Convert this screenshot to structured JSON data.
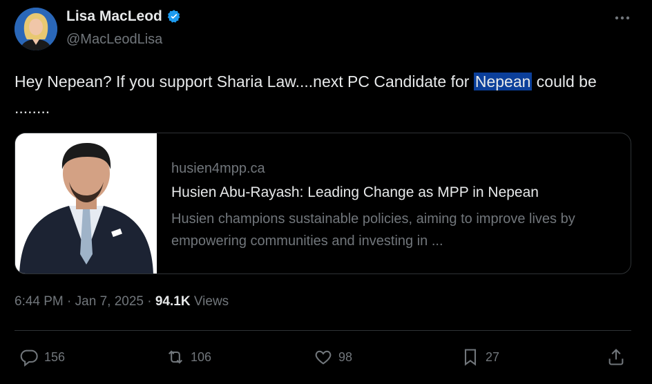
{
  "author": {
    "name": "Lisa MacLeod",
    "handle": "@MacLeodLisa",
    "verified_color": "#1d9bf0",
    "verified_icon": "verified-badge-icon"
  },
  "tweet": {
    "text_before": "Hey Nepean?  If you support Sharia Law....next PC Candidate for ",
    "text_highlight": "Nepean",
    "text_after": " could be ........"
  },
  "link_card": {
    "domain": "husien4mpp.ca",
    "title": "Husien Abu-Rayash: Leading Change as MPP in Nepean",
    "description": "Husien champions sustainable policies, aiming to improve lives by empowering communities and investing in ..."
  },
  "meta": {
    "time": "6:44 PM",
    "separator": " · ",
    "date": "Jan 7, 2025",
    "separator2": " · ",
    "views_count": "94.1K",
    "views_label": " Views"
  },
  "actions": {
    "replies": "156",
    "reposts": "106",
    "likes": "98",
    "bookmarks": "27"
  },
  "colors": {
    "background": "#000000",
    "text": "#e7e9ea",
    "secondary": "#71767b",
    "highlight": "#0b3f9a",
    "border": "#2f3336"
  }
}
